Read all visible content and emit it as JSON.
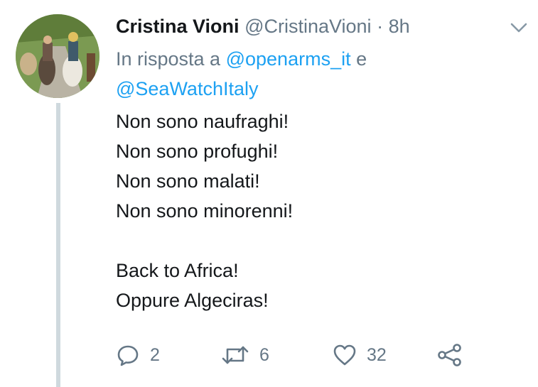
{
  "tweet": {
    "author_name": "Cristina Vioni",
    "handle": "@CristinaVioni",
    "separator": "·",
    "time": "8h",
    "reply_prefix": "In risposta a",
    "mentions": [
      "@openarms_it",
      "@SeaWatchItaly"
    ],
    "mention_joiner": "e",
    "lines": [
      "Non sono naufraghi!",
      "Non sono profughi!",
      "Non sono malati!",
      "Non sono minorenni!",
      "",
      "Back to Africa!",
      "Oppure Algeciras!"
    ],
    "counts": {
      "replies": "2",
      "retweets": "6",
      "likes": "32"
    }
  },
  "icons": {
    "menu": "chevron-down-icon",
    "reply": "reply-icon",
    "retweet": "retweet-icon",
    "like": "heart-icon",
    "share": "share-icon"
  },
  "colors": {
    "text": "#14171a",
    "secondary": "#657786",
    "link": "#1da1f2",
    "thread_line": "#cfd9de"
  }
}
